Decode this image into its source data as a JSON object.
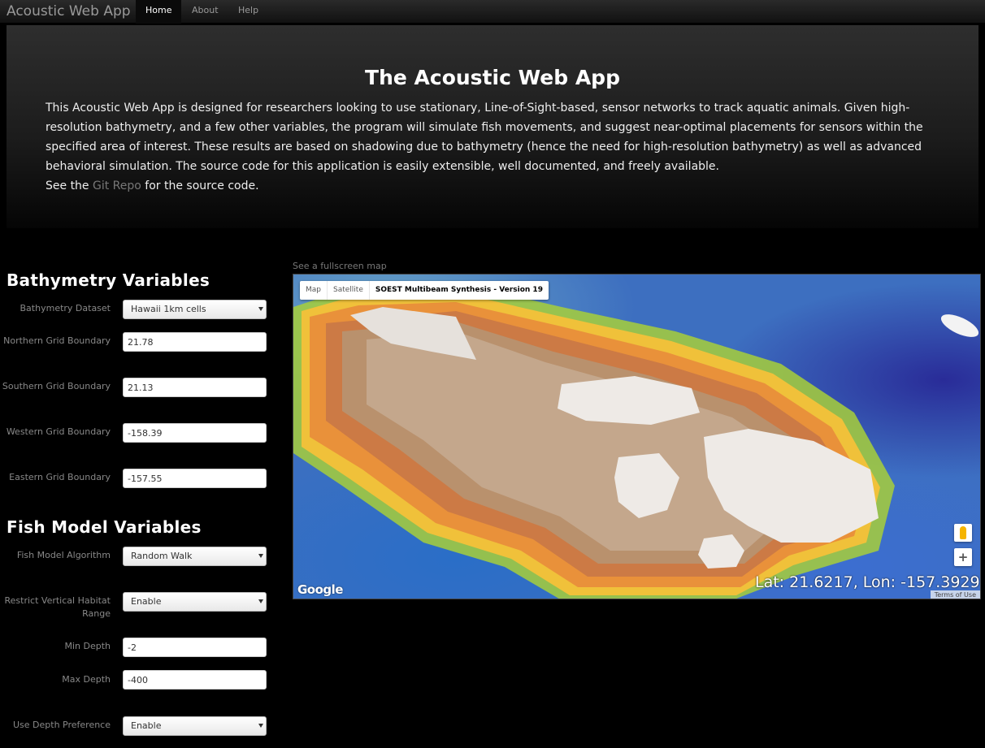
{
  "navbar": {
    "brand": "Acoustic Web App",
    "items": [
      {
        "label": "Home",
        "active": true
      },
      {
        "label": "About",
        "active": false
      },
      {
        "label": "Help",
        "active": false
      }
    ]
  },
  "hero": {
    "title": "The Acoustic Web App",
    "description": "This Acoustic Web App is designed for researchers looking to use stationary, Line-of-Sight-based, sensor networks to track aquatic animals. Given high-resolution bathymetry, and a few other variables, the program will simulate fish movements, and suggest near-optimal placements for sensors within the specified area of interest. These results are based on shadowing due to bathymetry (hence the need for high-resolution bathymetry) as well as advanced behavioral simulation. The source code for this application is easily extensible, well documented, and freely available.",
    "see_prefix": "See the ",
    "link_text": "Git Repo",
    "see_suffix": " for the source code."
  },
  "bathymetry": {
    "heading": "Bathymetry Variables",
    "dataset_label": "Bathymetry Dataset",
    "dataset_value": "Hawaii 1km cells",
    "north_label": "Northern Grid Boundary",
    "north_value": "21.78",
    "south_label": "Southern Grid Boundary",
    "south_value": "21.13",
    "west_label": "Western Grid Boundary",
    "west_value": "-158.39",
    "east_label": "Eastern Grid Boundary",
    "east_value": "-157.55"
  },
  "fish": {
    "heading": "Fish Model Variables",
    "algorithm_label": "Fish Model Algorithm",
    "algorithm_value": "Random Walk",
    "restrict_label": "Restrict Vertical Habitat Range",
    "restrict_value": "Enable",
    "min_depth_label": "Min Depth",
    "min_depth_value": "-2",
    "max_depth_label": "Max Depth",
    "max_depth_value": "-400",
    "depth_pref_label": "Use Depth Preference",
    "depth_pref_value": "Enable"
  },
  "map": {
    "fullscreen_link": "See a fullscreen map",
    "type_controls": [
      "Map",
      "Satellite",
      "SOEST Multibeam Synthesis - Version 19"
    ],
    "zoom_in": "+",
    "google_logo": "Google",
    "coords": "Lat: 21.6217, Lon: -157.3929",
    "terms": "Terms of Use"
  }
}
